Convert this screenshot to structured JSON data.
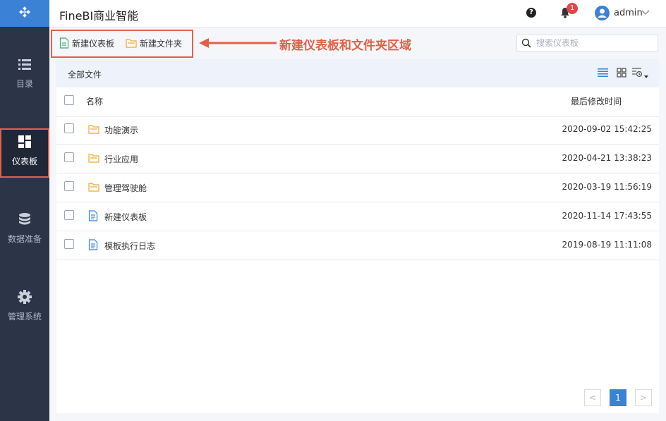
{
  "app": {
    "title": "FineBI商业智能"
  },
  "sidebar": {
    "items": [
      {
        "label": "目录",
        "icon": "list-icon"
      },
      {
        "label": "仪表板",
        "icon": "dashboard-icon",
        "active": true
      },
      {
        "label": "数据准备",
        "icon": "database-icon"
      },
      {
        "label": "管理系统",
        "icon": "gear-icon"
      }
    ]
  },
  "header": {
    "notification_count": "1",
    "user_name": "admin"
  },
  "toolbar": {
    "new_dashboard_label": "新建仪表板",
    "new_folder_label": "新建文件夹",
    "annotation": "新建仪表板和文件夹区域",
    "search_placeholder": "搜索仪表板"
  },
  "content": {
    "breadcrumb": "全部文件",
    "columns": {
      "name": "名称",
      "modified": "最后修改时间"
    },
    "rows": [
      {
        "type": "folder",
        "name": "功能演示",
        "modified": "2020-09-02 15:42:25"
      },
      {
        "type": "folder",
        "name": "行业应用",
        "modified": "2020-04-21 13:38:23"
      },
      {
        "type": "folder",
        "name": "管理驾驶舱",
        "modified": "2020-03-19 11:56:19"
      },
      {
        "type": "file",
        "name": "新建仪表板",
        "modified": "2020-11-14 17:43:55"
      },
      {
        "type": "file",
        "name": "模板执行日志",
        "modified": "2019-08-19 11:11:08"
      }
    ]
  },
  "pagination": {
    "current": "1",
    "prev": "<",
    "next": ">"
  },
  "colors": {
    "sidebar_bg": "#2c3548",
    "accent_blue": "#3b82d6",
    "annotation_red": "#e0614a",
    "folder_orange": "#f0a62e",
    "file_blue": "#3b82d6",
    "new_doc_green": "#3fae6a"
  }
}
